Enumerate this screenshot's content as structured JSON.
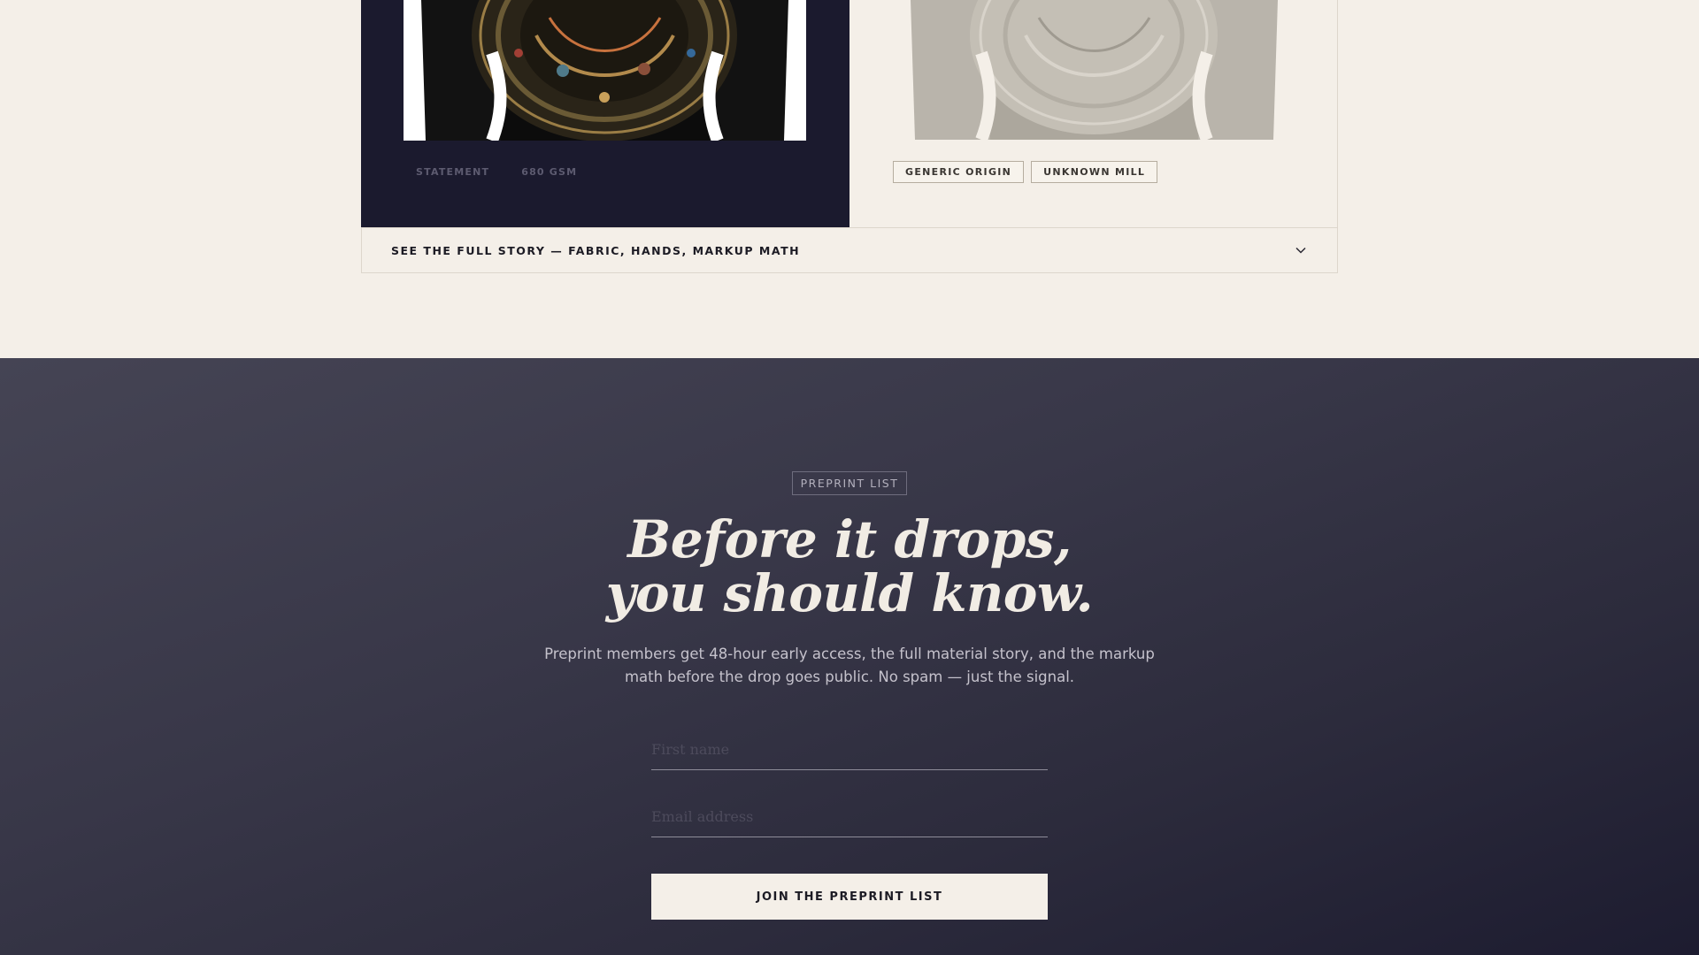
{
  "comparison": {
    "left": {
      "specs": [
        "STATEMENT",
        "680 GSM"
      ]
    },
    "right": {
      "tags": [
        "GENERIC ORIGIN",
        "UNKNOWN MILL"
      ]
    },
    "accordion": {
      "label": "SEE THE FULL STORY — FABRIC, HANDS, MARKUP MATH",
      "icon": "chevron-down-icon"
    }
  },
  "preprint": {
    "eyebrow": "PREPRINT LIST",
    "headline": [
      "Before it drops,",
      "you should know."
    ],
    "subcopy": "Preprint members get 48-hour early access, the full material story, and the markup math before the drop goes public. No spam — just the signal.",
    "name_placeholder": "First name",
    "email_placeholder": "Email address",
    "button_label": "JOIN THE PREPRINT LIST"
  },
  "colors": {
    "page_bg": "#f4efe8",
    "dark_panel": "#1b1a2e",
    "section_gradient_start": "#454454",
    "section_gradient_end": "#1d1c30"
  }
}
